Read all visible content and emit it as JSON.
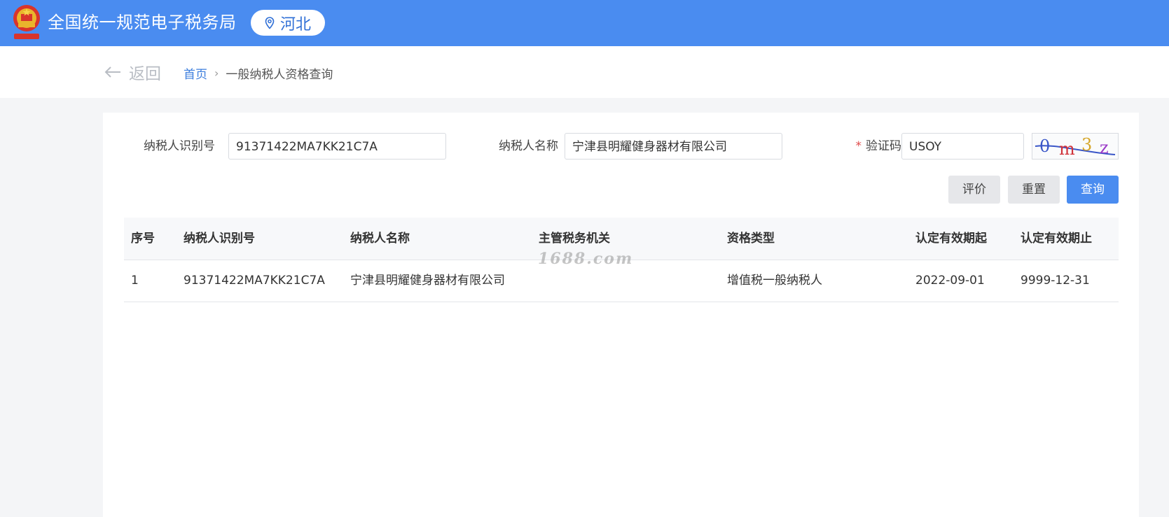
{
  "header": {
    "site_title": "全国统一规范电子税务局",
    "region": "河北",
    "brand_color": "#4a8cf0"
  },
  "breadcrumb": {
    "back_label": "返回",
    "home": "首页",
    "separator": "›",
    "current": "一般纳税人资格查询"
  },
  "form": {
    "taxpayer_id_label": "纳税人识别号",
    "taxpayer_id_value": "91371422MA7KK21C7A",
    "taxpayer_name_label": "纳税人名称",
    "taxpayer_name_value": "宁津县明耀健身器材有限公司",
    "captcha_label": "验证码",
    "captcha_required_mark": "*",
    "captcha_value": "USOY",
    "captcha_image_text": "0m3z"
  },
  "buttons": {
    "evaluate": "评价",
    "reset": "重置",
    "query": "查询"
  },
  "table": {
    "headers": [
      "序号",
      "纳税人识别号",
      "纳税人名称",
      "主管税务机关",
      "资格类型",
      "认定有效期起",
      "认定有效期止"
    ],
    "rows": [
      [
        "1",
        "91371422MA7KK21C7A",
        "宁津县明耀健身器材有限公司",
        "",
        "增值税一般纳税人",
        "2022-09-01",
        "9999-12-31"
      ]
    ]
  },
  "watermark": "1688.com"
}
